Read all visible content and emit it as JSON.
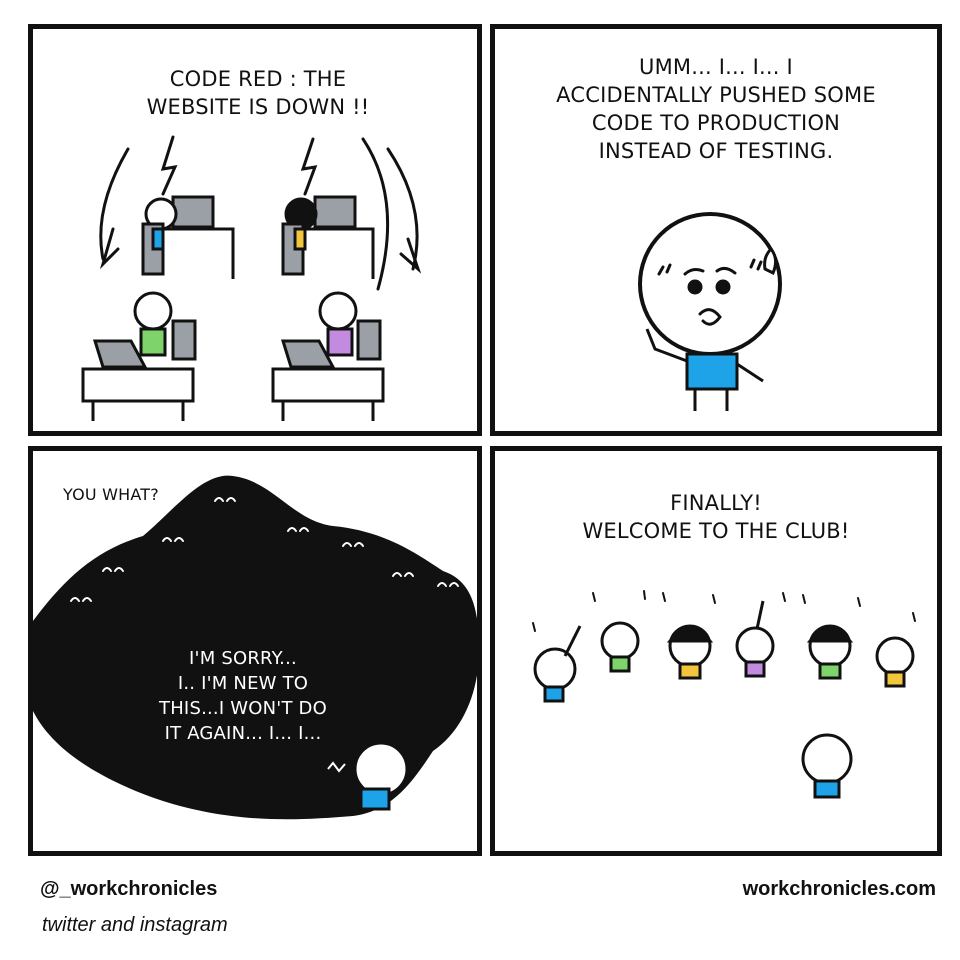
{
  "panels": [
    {
      "caption_lines": [
        "CODE RED : THE",
        "WEBSITE IS DOWN !!"
      ]
    },
    {
      "caption_lines": [
        "UMM... I... I... I",
        "ACCIDENTALLY PUSHED SOME",
        "CODE TO PRODUCTION",
        "INSTEAD OF TESTING."
      ]
    },
    {
      "caption_top": "YOU WHAT?",
      "caption_lines": [
        "I'M SORRY...",
        "I.. I'M NEW TO",
        "THIS...I WON'T DO",
        "IT AGAIN... I... I..."
      ]
    },
    {
      "caption_lines": [
        "FINALLY!",
        "WELCOME TO THE CLUB!"
      ]
    }
  ],
  "footer": {
    "handle": "@_workchronicles",
    "platforms": "twitter and instagram",
    "website": "workchronicles.com"
  },
  "colors": {
    "ink": "#111111",
    "blue_shirt": "#1fa3e8",
    "green_shirt": "#7ed36a",
    "purple_shirt": "#c28be0",
    "yellow_shirt": "#f2c53d"
  }
}
